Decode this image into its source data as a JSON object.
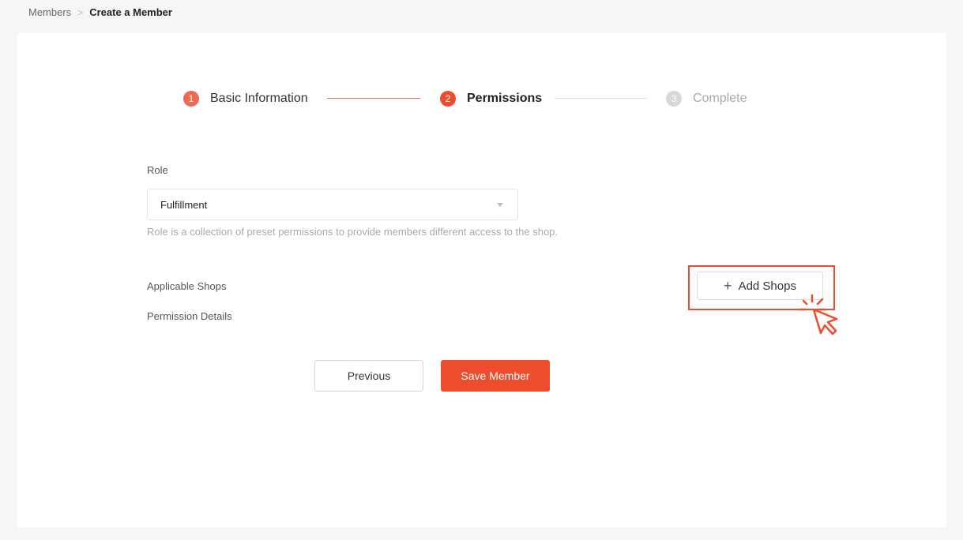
{
  "breadcrumb": {
    "parent": "Members",
    "separator": ">",
    "current": "Create a Member"
  },
  "stepper": {
    "steps": [
      {
        "number": "1",
        "label": "Basic Information",
        "state": "done"
      },
      {
        "number": "2",
        "label": "Permissions",
        "state": "active"
      },
      {
        "number": "3",
        "label": "Complete",
        "state": "todo"
      }
    ]
  },
  "form": {
    "role_label": "Role",
    "role_value": "Fulfillment",
    "role_hint": "Role is a collection of preset permissions to provide members different access to the shop.",
    "applicable_shops_label": "Applicable Shops",
    "permission_details_label": "Permission Details",
    "add_shops_button": "Add Shops",
    "add_shops_icon": "plus-icon"
  },
  "actions": {
    "previous_label": "Previous",
    "save_label": "Save Member"
  },
  "colors": {
    "accent": "#ee4d2d",
    "done": "#ee6a53",
    "todo": "#d8d8d8"
  }
}
